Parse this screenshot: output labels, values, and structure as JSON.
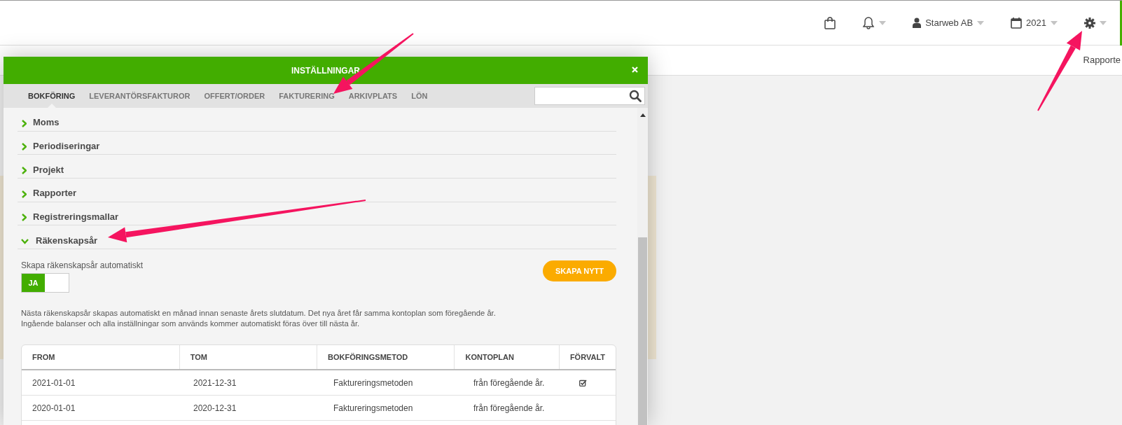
{
  "top_bar": {
    "company": "Starweb AB",
    "year": "2021"
  },
  "sub_bar": {
    "link": "Rapporte"
  },
  "dialog": {
    "title": "INSTÄLLNINGAR",
    "tabs": [
      {
        "label": "BOKFÖRING",
        "selected": true
      },
      {
        "label": "LEVERANTÖRSFAKTUROR",
        "selected": false
      },
      {
        "label": "OFFERT/ORDER",
        "selected": false
      },
      {
        "label": "FAKTURERING",
        "selected": false
      },
      {
        "label": "ARKIVPLATS",
        "selected": false
      },
      {
        "label": "LÖN",
        "selected": false
      }
    ],
    "sections": [
      {
        "label": "Moms",
        "expanded": false
      },
      {
        "label": "Periodiseringar",
        "expanded": false
      },
      {
        "label": "Projekt",
        "expanded": false
      },
      {
        "label": "Rapporter",
        "expanded": false
      },
      {
        "label": "Registreringsmallar",
        "expanded": false
      },
      {
        "label": "Räkenskapsår",
        "expanded": true
      }
    ],
    "fiscal_year": {
      "toggle": {
        "label": "Skapa räkenskapsår automatiskt",
        "value_label": "JA",
        "on": true
      },
      "create_button": "SKAPA NYTT",
      "description_lines": [
        "Nästa räkenskapsår skapas automatiskt en månad innan senaste årets slutdatum. Det nya året får samma kontoplan som föregående år.",
        "Ingående balanser och alla inställningar som används kommer automatiskt föras över till nästa år."
      ],
      "table": {
        "columns": [
          "FROM",
          "TOM",
          "BOKFÖRINGSMETOD",
          "KONTOPLAN",
          "FÖRVALT"
        ],
        "rows": [
          {
            "cells": [
              "2021-01-01",
              "2021-12-31",
              "Faktureringsmetoden",
              "från föregående år."
            ],
            "default": true
          },
          {
            "cells": [
              "2020-01-01",
              "2020-12-31",
              "Faktureringsmetoden",
              "från föregående år."
            ],
            "default": false
          }
        ]
      }
    }
  }
}
